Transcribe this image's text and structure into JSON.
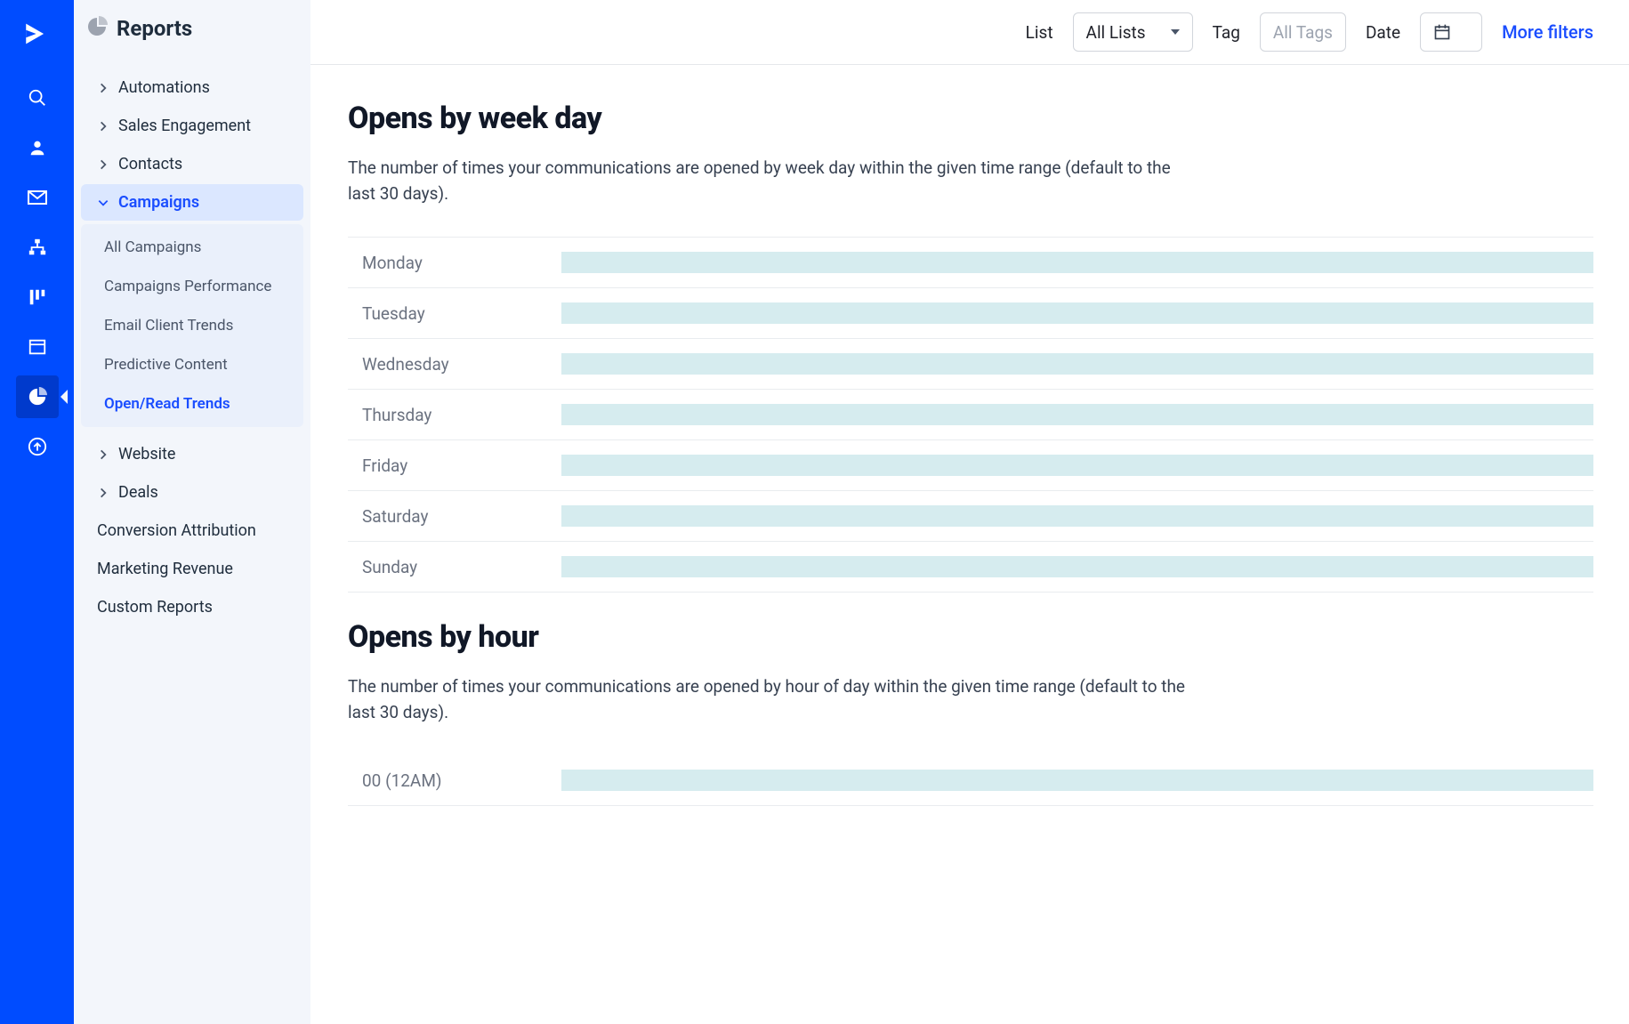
{
  "rail": {
    "items": [
      "logo",
      "search",
      "contact",
      "email",
      "sitemap",
      "board",
      "content",
      "reports",
      "upgrade"
    ],
    "active": "reports"
  },
  "sidebar": {
    "title": "Reports",
    "groups": [
      {
        "label": "Automations",
        "expanded": false
      },
      {
        "label": "Sales Engagement",
        "expanded": false
      },
      {
        "label": "Contacts",
        "expanded": false
      },
      {
        "label": "Campaigns",
        "expanded": true,
        "subs": [
          {
            "label": "All Campaigns",
            "active": false
          },
          {
            "label": "Campaigns Performance",
            "active": false
          },
          {
            "label": "Email Client Trends",
            "active": false
          },
          {
            "label": "Predictive Content",
            "active": false
          },
          {
            "label": "Open/Read Trends",
            "active": true
          }
        ]
      },
      {
        "label": "Website",
        "expanded": false
      },
      {
        "label": "Deals",
        "expanded": false
      }
    ],
    "flat": [
      {
        "label": "Conversion Attribution"
      },
      {
        "label": "Marketing Revenue"
      },
      {
        "label": "Custom Reports"
      }
    ]
  },
  "filters": {
    "list_label": "List",
    "list_value": "All Lists",
    "tag_label": "Tag",
    "tag_placeholder": "All Tags",
    "date_label": "Date",
    "more": "More filters"
  },
  "sections": {
    "week": {
      "title": "Opens by week day",
      "desc": "The number of times your communications are opened by week day within the given time range (default to the last 30 days).",
      "rows": [
        "Monday",
        "Tuesday",
        "Wednesday",
        "Thursday",
        "Friday",
        "Saturday",
        "Sunday"
      ]
    },
    "hour": {
      "title": "Opens by hour",
      "desc": "The number of times your communications are opened by hour of day within the given time range (default to the last 30 days).",
      "rows": [
        "00 (12AM)"
      ]
    }
  },
  "chart_data": [
    {
      "type": "bar",
      "title": "Opens by week day",
      "categories": [
        "Monday",
        "Tuesday",
        "Wednesday",
        "Thursday",
        "Friday",
        "Saturday",
        "Sunday"
      ],
      "values": [
        null,
        null,
        null,
        null,
        null,
        null,
        null
      ],
      "note": "placeholder skeleton bars, no numeric values shown"
    },
    {
      "type": "bar",
      "title": "Opens by hour",
      "categories": [
        "00 (12AM)"
      ],
      "values": [
        null
      ],
      "note": "placeholder skeleton bars, only first row visible"
    }
  ]
}
